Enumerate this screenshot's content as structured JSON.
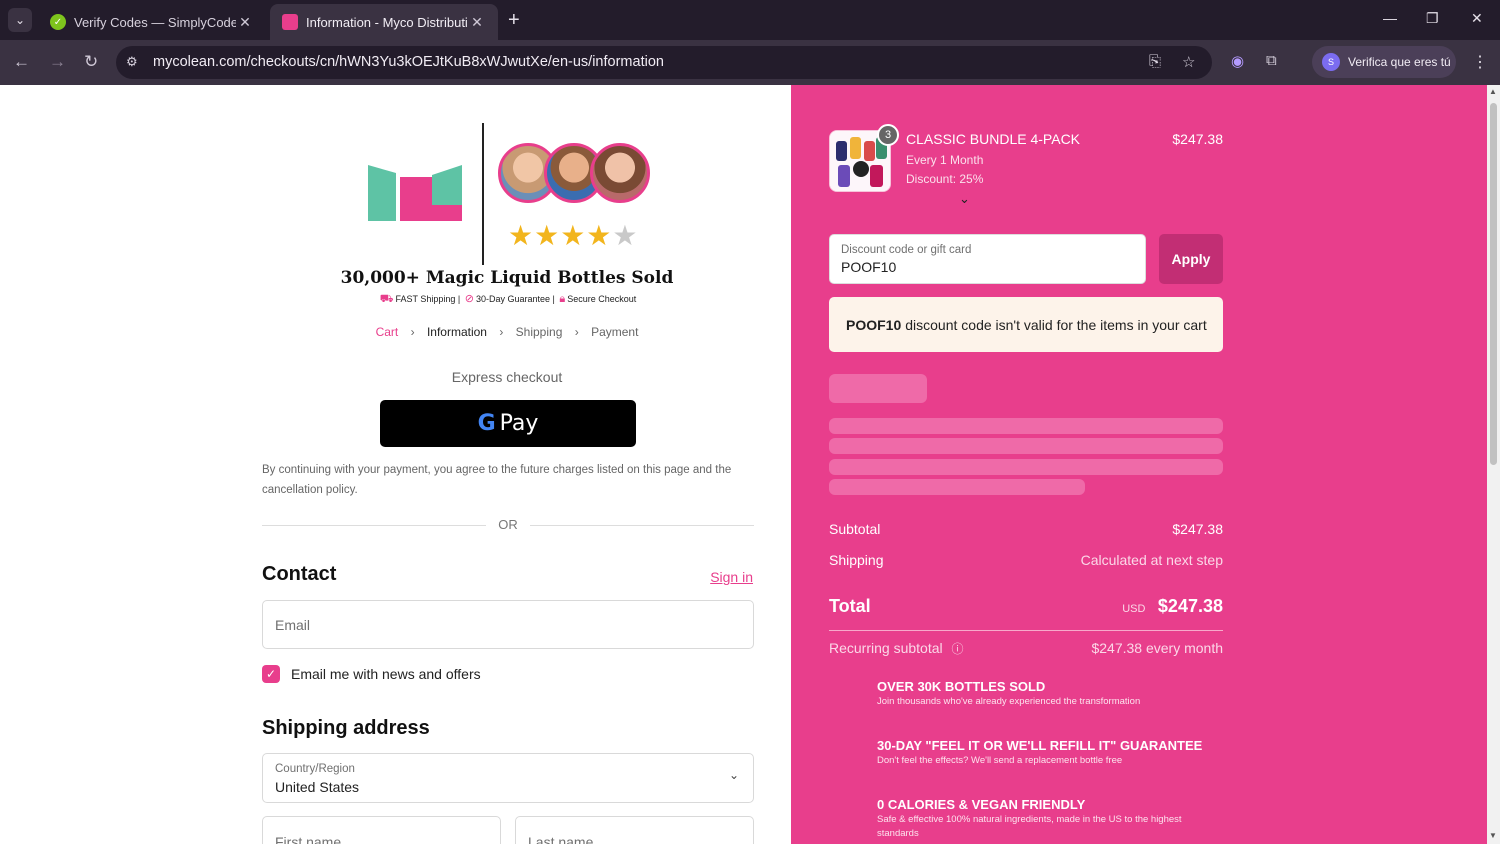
{
  "browser": {
    "tabs": [
      {
        "title": "Verify Codes — SimplyCodes",
        "active": false
      },
      {
        "title": "Information - Myco Distribution",
        "active": true
      }
    ],
    "url": "mycolean.com/checkouts/cn/hWN3Yu3kOEJtKuB8xWJwutXe/en-us/information",
    "profile_label": "Verifica que eres tú",
    "profile_initial": "S"
  },
  "brand": {
    "headline": "30,000+ Magic Liquid Bottles Sold",
    "badges": [
      "FAST Shipping |",
      "30-Day Guarantee |",
      "Secure Checkout"
    ],
    "colors": {
      "accent": "#e83e8c",
      "teal": "#5ec3a5"
    }
  },
  "breadcrumbs": {
    "cart": "Cart",
    "information": "Information",
    "shipping": "Shipping",
    "payment": "Payment"
  },
  "express": {
    "title": "Express checkout",
    "gpay_label": "Pay",
    "legal": "By continuing with your payment, you agree to the future charges listed on this page and the cancellation policy.",
    "or": "OR"
  },
  "contact": {
    "title": "Contact",
    "sign_in": "Sign in",
    "email_placeholder": "Email",
    "newsletter_label": "Email me with news and offers",
    "newsletter_checked": true
  },
  "shipping": {
    "title": "Shipping address",
    "country_label": "Country/Region",
    "country_value": "United States",
    "first_name_placeholder": "First name",
    "last_name_placeholder": "Last name"
  },
  "order": {
    "item": {
      "name": "CLASSIC BUNDLE 4-PACK",
      "frequency": "Every 1 Month",
      "discount": "Discount: 25%",
      "price": "$247.38",
      "quantity": "3"
    },
    "discount_field": {
      "label": "Discount code or gift card",
      "value": "POOF10"
    },
    "apply_label": "Apply",
    "alert": {
      "code": "POOF10",
      "message": "discount code isn't valid for the items in your cart"
    },
    "subtotal_label": "Subtotal",
    "subtotal_value": "$247.38",
    "shipping_label": "Shipping",
    "shipping_value": "Calculated at next step",
    "total_label": "Total",
    "total_currency": "USD",
    "total_value": "$247.38",
    "recurring_label": "Recurring subtotal",
    "recurring_value": "$247.38 every month"
  },
  "features": [
    {
      "title": "OVER 30K BOTTLES SOLD",
      "desc": "Join thousands who've already experienced the transformation"
    },
    {
      "title": "30-DAY \"FEEL IT OR WE'LL REFILL IT\" GUARANTEE",
      "desc": "Don't feel the effects? We'll send a replacement bottle free"
    },
    {
      "title": "0 CALORIES & VEGAN FRIENDLY",
      "desc": "Safe & effective 100% natural ingredients, made in the US to the highest standards"
    }
  ]
}
